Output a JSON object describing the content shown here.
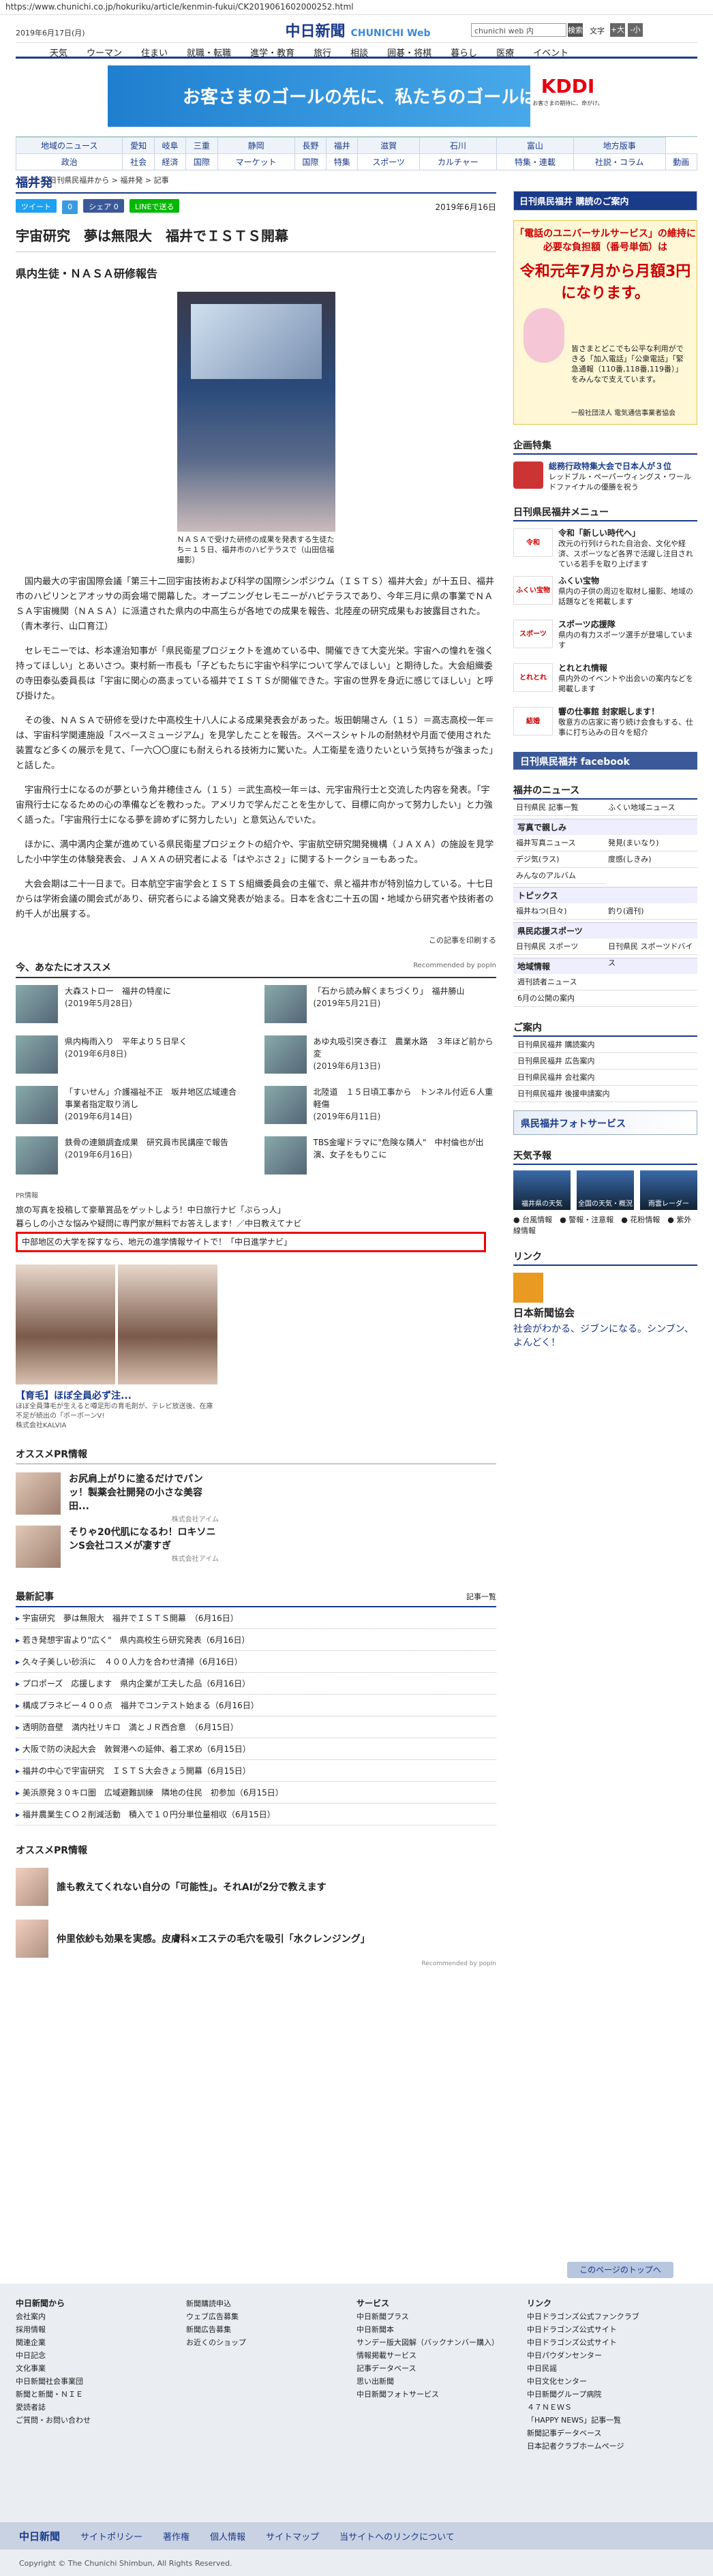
{
  "url": "https://www.chunichi.co.jp/hokuriku/article/kenmin-fukui/CK2019061602000252.html",
  "header": {
    "date": "2019年6月17日(月)",
    "logo_main": "中日新聞",
    "logo_sub": "CHUNICHI Web",
    "search_value": "chunichi web 内",
    "search_button": "検索",
    "fontsize_label": "文字",
    "fontsize_up": "+大",
    "fontsize_down": "-小",
    "nav": [
      "天気",
      "ウーマン",
      "住まい",
      "就職・転職",
      "進学・教育",
      "旅行",
      "相談",
      "囲碁・将棋",
      "暮らし",
      "医療",
      "イベント"
    ]
  },
  "ad_banner": {
    "text": "お客さまのゴールの先に、私たちのゴールはある。",
    "brand": "KDDI",
    "brand_sub": "お客さまの期待に、命がけ。"
  },
  "region_nav": {
    "row1": [
      "地域のニュース",
      "愛知",
      "岐阜",
      "三重",
      "静岡",
      "長野",
      "福井",
      "滋賀",
      "石川",
      "富山",
      "地方版事"
    ],
    "row2": [
      "政治",
      "社会",
      "経済",
      "国際",
      "マーケット",
      "国際",
      "特集",
      "スポーツ",
      "カルチャー",
      "特集・連載",
      "社説・コラム",
      "動画"
    ]
  },
  "breadcrumb": "トップ > 日刊県民福井から > 福井発 > 記事",
  "article": {
    "section": "福井発",
    "share_buttons": [
      "ツイート",
      "0",
      "シェア 0",
      "LINEで送る"
    ],
    "date": "2019年6月16日",
    "headline": "宇宙研究　夢は無限大　福井でＩＳＴＳ開幕",
    "subhead": "県内生徒・ＮＡＳＡ研修報告",
    "photo_caption": "ＮＡＳＡで受けた研修の成果を発表する生徒たち＝１５日、福井市のハピテラスで（山田信福撮影）",
    "paragraphs": [
      "国内最大の宇宙国際会議「第三十二回宇宙技術および科学の国際シンポジウム（ＩＳＴＳ）福井大会」が十五日、福井市のハピリンとアオッサの両会場で開幕した。オープニングセレモニーがハピテラスであり、今年三月に県の事業でＮＡＳＡ宇宙機関（ＮＡＳＡ）に派遣された県内の中高生らが各地での成果を報告、北陸産の研究成果もお披露目された。（青木孝行、山口育江）",
      "セレモニーでは、杉本達治知事が「県民衛星プロジェクトを進めている中、開催できて大変光栄。宇宙への憧れを強く持ってほしい」とあいさつ。東村新一市長も「子どもたちに宇宙や科学について学んでほしい」と期待した。大会組織委の寺田泰弘委員長は「宇宙に関心の高まっている福井でＩＳＴＳが開催できた。宇宙の世界を身近に感じてほしい」と呼び掛けた。",
      "その後、ＮＡＳＡで研修を受けた中高校生十八人による成果発表会があった。坂田朝陽さん（１５）＝高志高校一年＝は、宇宙科学関連施設「スペースミュージアム」を見学したことを報告。スペースシャトルの耐熱材や月面で使用された装置など多くの展示を見て、「一六〇〇度にも耐えられる技術力に驚いた。人工衛星を造りたいという気持ちが強まった」と話した。",
      "宇宙飛行士になるのが夢という角井穂佳さん（１５）＝武生高校一年＝は、元宇宙飛行士と交流した内容を発表。「宇宙飛行士になるための心の準備などを教わった。アメリカで学んだことを生かして、目標に向かって努力したい」と力強く語った。「宇宙飛行士になる夢を諦めずに努力したい」と意気込んでいた。",
      "ほかに、満中満内企業が進めている県民衛星プロジェクトの紹介や、宇宙航空研究開発機構（ＪＡＸＡ）の施設を見学した小中学生の体験発表会、ＪＡＸＡの研究者による「はやぶさ２」に関するトークショーもあった。",
      "大会会期は二十一日まで。日本航空宇宙学会とＩＳＴＳ組織委員会の主催で、県と福井市が特別協力している。十七日からは学術会議の開会式があり、研究者らによる論文発表が始まる。日本を含む二十五の国・地域から研究者や技術者の約千人が出展する。"
    ],
    "report_link": "この記事を印刷する"
  },
  "osusume": {
    "title": "今、あなたにオススメ",
    "recommended_by": "Recommended by popIn",
    "items": [
      {
        "title": "大森ストロー　福井の特産に",
        "date": "(2019年5月28日)"
      },
      {
        "title": "「石から読み解くまちづくり」　福井勝山",
        "date": "(2019年5月21日)"
      },
      {
        "title": "県内梅雨入り　平年より５日早く",
        "date": "(2019年6月8日)"
      },
      {
        "title": "あゆ丸吸引突き春江　農業水路　３年ほど前から変",
        "date": "(2019年6月13日)"
      },
      {
        "title": "「すいせん」介護福祉不正　坂井地区広域連合　事業者指定取り消し",
        "date": "(2019年6月14日)"
      },
      {
        "title": "北陸道　１５日頃工事から　トンネル付近６人重軽傷",
        "date": "(2019年6月11日)"
      },
      {
        "title": "鉄骨の連鎖調査成果　研究員市民講座で報告",
        "date": "(2019年6月16日)"
      },
      {
        "title": "TBS金曜ドラマに\"危険な隣人\"　中村倫也が出演、女子をもりこに",
        "date": ""
      }
    ]
  },
  "pr_links": {
    "label": "PR情報",
    "items": [
      "旅の写真を投稿して豪華賞品をゲットしよう！中日旅行ナビ「ぷらっ人」",
      "暮らしの小さな悩みや疑問に専門家が無料でお答えします！／中日教えてナビ",
      "中部地区の大学を探すなら、地元の進学情報サイトで！「中日進学ナビ」"
    ]
  },
  "hair_ad": {
    "title": "【育毛】ほぼ全員必ず注...",
    "text": "ほぼ全員薄毛が生えると噂足形の育毛剤が、テレビ放送後、在庫不足が続出の「ボーボーンV!",
    "source": "株式会社KALVIA"
  },
  "pr2": {
    "title": "オススメPR情報",
    "items": [
      {
        "title": "お尻肩上がりに塗るだけでパンッ！製薬会社開発の小さな美容田...",
        "source": "株式会社アイム"
      },
      {
        "title": "そりゃ20代肌になるわ！ロキソニンS会社コスメが凄すぎ",
        "source": "株式会社アイム"
      }
    ]
  },
  "latest": {
    "title": "最新記事",
    "all_link": "記事一覧",
    "items": [
      "宇宙研究　夢は無限大　福井でＩＳＴＳ開幕　（6月16日）",
      "若き発想宇宙より\"広く\"　県内高校生ら研究発表（6月16日）",
      "久々子美しい砂浜に　４００人力を合わせ清掃（6月16日）",
      "プロポーズ　応援します　県内企業が工夫した品（6月16日）",
      "構成プラネビー４００点　福井でコンテスト始まる（6月16日）",
      "透明防音壁　満内社リキロ　満とＪＲ西合意　（6月15日）",
      "大阪で防の決起大会　敦賀港への延伸、着工求め（6月15日）",
      "福井の中心で宇宙研究　ＩＳＴＳ大会きょう開幕（6月15日）",
      "美浜原発３０キロ圏　広域避難訓練　隣地の住民　初参加（6月15日）",
      "福井農業生ＣＯ２削減活動　積入で１０円分単位量相収（6月15日）"
    ]
  },
  "pr_bottom": {
    "title": "オススメPR情報",
    "source": "Recommended by popIn",
    "items": [
      "誰も教えてくれない自分の「可能性」。それAIが2分で教えます",
      "仲里依紗も効果を実感。皮膚科×エステの毛穴を吸引「水クレンジング」"
    ]
  },
  "sidebar": {
    "kenmin_header": "日刊県民福井 購読のご案内",
    "ad": {
      "line1": "「電話のユニバーサルサービス」の維持に必要な負担額（番号単価）は",
      "line2": "令和元年7月から月額3円になります。",
      "line3": "皆さまとどこでも公平な利用ができる「加入電話」「公衆電話」「緊急通報（110番,118番,119番）」をみんなで支えています。",
      "line4": "一般社団法人 電気通信事業者協会"
    },
    "features_title": "企画特集",
    "features": [
      {
        "title": "総務行政特集大会で日本人が３位",
        "text": "レッドブル・ペーパーウィングス・ワールドファイナルの優勝を祝う"
      }
    ],
    "menu_title": "日刊県民福井メニュー",
    "menu": [
      {
        "badge": "令和",
        "title": "令和「新しい時代へ」",
        "text": "改元の行列けられた自治会、文化や経済、スポーツなど各界で活躍し注目されている若手を取り上げます"
      },
      {
        "badge": "ふくい宝物",
        "title": "ふくい宝物",
        "text": "県内の子供の周辺を取材し撮影、地域の話題などを掲載します"
      },
      {
        "badge": "スポーツ",
        "title": "スポーツ応援隊",
        "text": "県内の有力スポーツ選手が登場しています"
      },
      {
        "badge": "とれとれ",
        "title": "とれとれ情報",
        "text": "県内外のイベントや出会いの案内などを掲載します"
      },
      {
        "badge": "結婚",
        "title": "響の仕事館 封家眠します！",
        "text": "敬意方の店家に寄り続け会食もする、仕事に打ち込みの日々を紹介"
      }
    ],
    "facebook": "日刊県民福井 facebook",
    "news_title": "福井のニュース",
    "news": [
      "日刊県民 記事一覧",
      "ふくい地域ニュース"
    ],
    "photo_title": "写真で親しみ",
    "photo_links": [
      "福井写真ニュース",
      "発見(まいなり)",
      "デジ気(ラス)",
      "度感(しきみ)",
      "みんなのアルバム"
    ],
    "topics_title": "トピックス",
    "topics": [
      "福井ねつ(日々)",
      "釣り(週刊)"
    ],
    "sports_title": "県民応援スポーツ",
    "sports": [
      "日刊県民 スポーツ",
      "日刊県民 スポーツドバイス"
    ],
    "local_title": "地域情報",
    "local": [
      "週刊読者ニュース",
      "6月の公開の案内"
    ],
    "guide_title": "ご案内",
    "guide": [
      "日刊県民福井 購読案内",
      "日刊県民福井 広告案内",
      "日刊県民福井 会社案内",
      "日刊県民福井 後援申請案内"
    ],
    "photo_service": "県民福井フォトサービス",
    "weather_title": "天気予報",
    "weather": [
      "福井県の天気",
      "全国の天気・概況",
      "雨雲レーダー"
    ],
    "weather_links": "● 台風情報　● 警報・注意報　● 花粉情報　● 紫外線情報",
    "link_title": "リンク",
    "nikkei_name": "日本新聞協会",
    "nikkei_slogan": "社会がわかる、ジブンになる。シンブン、よんどく！"
  },
  "footer": {
    "back_to_top": "このページのトップへ",
    "cols": [
      {
        "heading": "中日新聞から",
        "items": [
          "会社案内",
          "採用情報",
          "関連企業",
          "中日記念",
          "文化事業",
          "中日新聞社会事業団",
          "新聞と新聞・ＮＩＥ",
          "愛読者誌",
          "ご質問・お問い合わせ"
        ]
      },
      {
        "heading": "",
        "items": [
          "新聞購読申込",
          "ウェブ広告募集",
          "新聞広告募集",
          "お近くのショップ"
        ]
      },
      {
        "heading": "サービス",
        "items": [
          "中日新聞プラス",
          "中日新聞本",
          "サンデー版大図解（バックナンバー購入）",
          "情報掲載サービス",
          "記事データベース",
          "思い出新聞",
          "中日新聞フォトサービス"
        ]
      },
      {
        "heading": "リンク",
        "items": [
          "中日ドラゴンズ公式ファンクラブ",
          "中日ドラゴンズ公式サイト",
          "中日ドラゴンズ公式サイト",
          "中日パウダンセンター",
          "中日民謡",
          "中日文化センター",
          "中日新聞グループ病院",
          "４７ＮＥＷＳ",
          "「HAPPY NEWS」記事一覧",
          "新聞記事データベース",
          "日本記者クラブホームページ"
        ]
      }
    ],
    "bar": [
      "中日新聞",
      "サイトポリシー",
      "著作権",
      "個人情報",
      "サイトマップ",
      "当サイトへのリンクについて"
    ],
    "copyright": "Copyright © The Chunichi Shimbun, All Rights Reserved."
  }
}
